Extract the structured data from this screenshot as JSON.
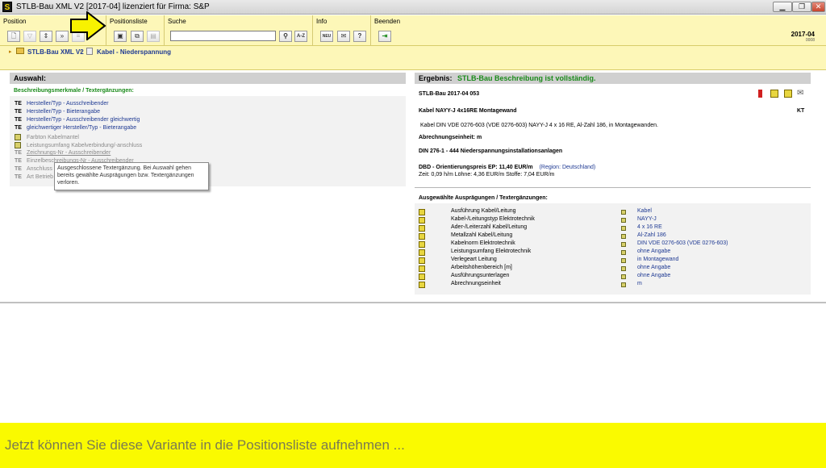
{
  "window": {
    "title": "STLB-Bau XML V2 [2017-04] lizenziert für Firma: S&P",
    "app_icon_letter": "S"
  },
  "toolbar": {
    "groups": {
      "position": "Position",
      "positionsliste": "Positionsliste",
      "suche": "Suche",
      "info": "Info",
      "beenden": "Beenden"
    },
    "search": {
      "value": "",
      "placeholder": ""
    },
    "search_binoculars_label": "⚲",
    "search_az_label": "A-Z",
    "info_new_label": "NEU",
    "version": "2017-04",
    "version_sub": "0008"
  },
  "breadcrumb": {
    "root": "STLB-Bau XML V2",
    "current": "Kabel - Niederspannung"
  },
  "left": {
    "header": "Auswahl:",
    "subheader": "Beschreibungsmerkmale / Textergänzungen:",
    "items": [
      {
        "tag": "TE",
        "label": "Hersteller/Typ - Ausschreibender"
      },
      {
        "tag": "TE",
        "label": "Hersteller/Typ - Bieterangabe"
      },
      {
        "tag": "TE",
        "label": "Hersteller/Typ - Ausschreibender gleichwertig"
      },
      {
        "tag": "TE",
        "label": "gleichwertiger Hersteller/Typ - Bieterangabe"
      },
      {
        "tag": "",
        "label": "Farbton Kabelmantel"
      },
      {
        "tag": "",
        "label": "Leistungsumfang Kabelverbindung/-anschluss"
      },
      {
        "tag": "",
        "label": "Zeichnungs-Nr - Ausschreibender"
      },
      {
        "tag": "",
        "label": "Einzelbeschreibungs-Nr - Ausschreibender"
      },
      {
        "tag": "",
        "label": "Anschluss"
      },
      {
        "tag": "",
        "label": "Art Betrieb"
      }
    ],
    "tooltip": "Ausgeschlossene Textergänzung. Bei Auswahl gehen bereits gewählte Ausprägungen bzw. Textergänzungen verloren."
  },
  "right": {
    "header_label": "Ergebnis:",
    "header_status": "STLB-Bau Beschreibung ist vollständig.",
    "ref": "STLB-Bau 2017-04 053",
    "short_title": "Kabel NAYY-J 4x16RE Montagewand",
    "unit_code": "KT",
    "long_text": "Kabel DIN VDE 0276-603 (VDE 0276-603) NAYY-J 4 x 16 RE, Al-Zahl 186, in Montagewanden.",
    "abrechnung": "Abrechnungseinheit: m",
    "din": "DIN 276-1 - 444 Niederspannungsinstallationsanlagen",
    "price_label": "DBD - Orientierungspreis EP: 11,40 EUR/m",
    "price_region": "(Region: Deutschland)",
    "price_detail": "Zeit: 0,09 h/m    Löhne: 4,36 EUR/m    Stoffe: 7,04 EUR/m",
    "selected_header": "Ausgewählte Ausprägungen / Textergänzungen:",
    "selected": [
      {
        "name": "Ausführung Kabel/Leitung",
        "value": "Kabel"
      },
      {
        "name": "Kabel-/Leitungstyp Elektrotechnik",
        "value": "NAYY-J"
      },
      {
        "name": "Ader-/Leiterzahl Kabel/Leitung",
        "value": "4 x 16 RE"
      },
      {
        "name": "Metallzahl Kabel/Leitung",
        "value": "Al-Zahl 186"
      },
      {
        "name": "Kabelnorm Elektrotechnik",
        "value": "DIN VDE 0276-603 (VDE 0276-603)"
      },
      {
        "name": "Leistungsumfang Elektrotechnik",
        "value": "ohne Angabe"
      },
      {
        "name": "Verlegeart Leitung",
        "value": "in Montagewand"
      },
      {
        "name": "Arbeitshöhenbereich [m]",
        "value": "ohne Angabe"
      },
      {
        "name": "Ausführungsunterlagen",
        "value": "ohne Angabe"
      },
      {
        "name": "Abrechnungseinheit",
        "value": "m"
      }
    ]
  },
  "banner": {
    "text": "Jetzt können Sie diese Variante in die Positionsliste aufnehmen ..."
  },
  "colors": {
    "toolbar_bg": "#fdf7b8",
    "banner_bg": "#fafa00",
    "arrow": "#f8f200",
    "link_blue": "#1f3a93",
    "status_green": "#1a8a1a"
  }
}
